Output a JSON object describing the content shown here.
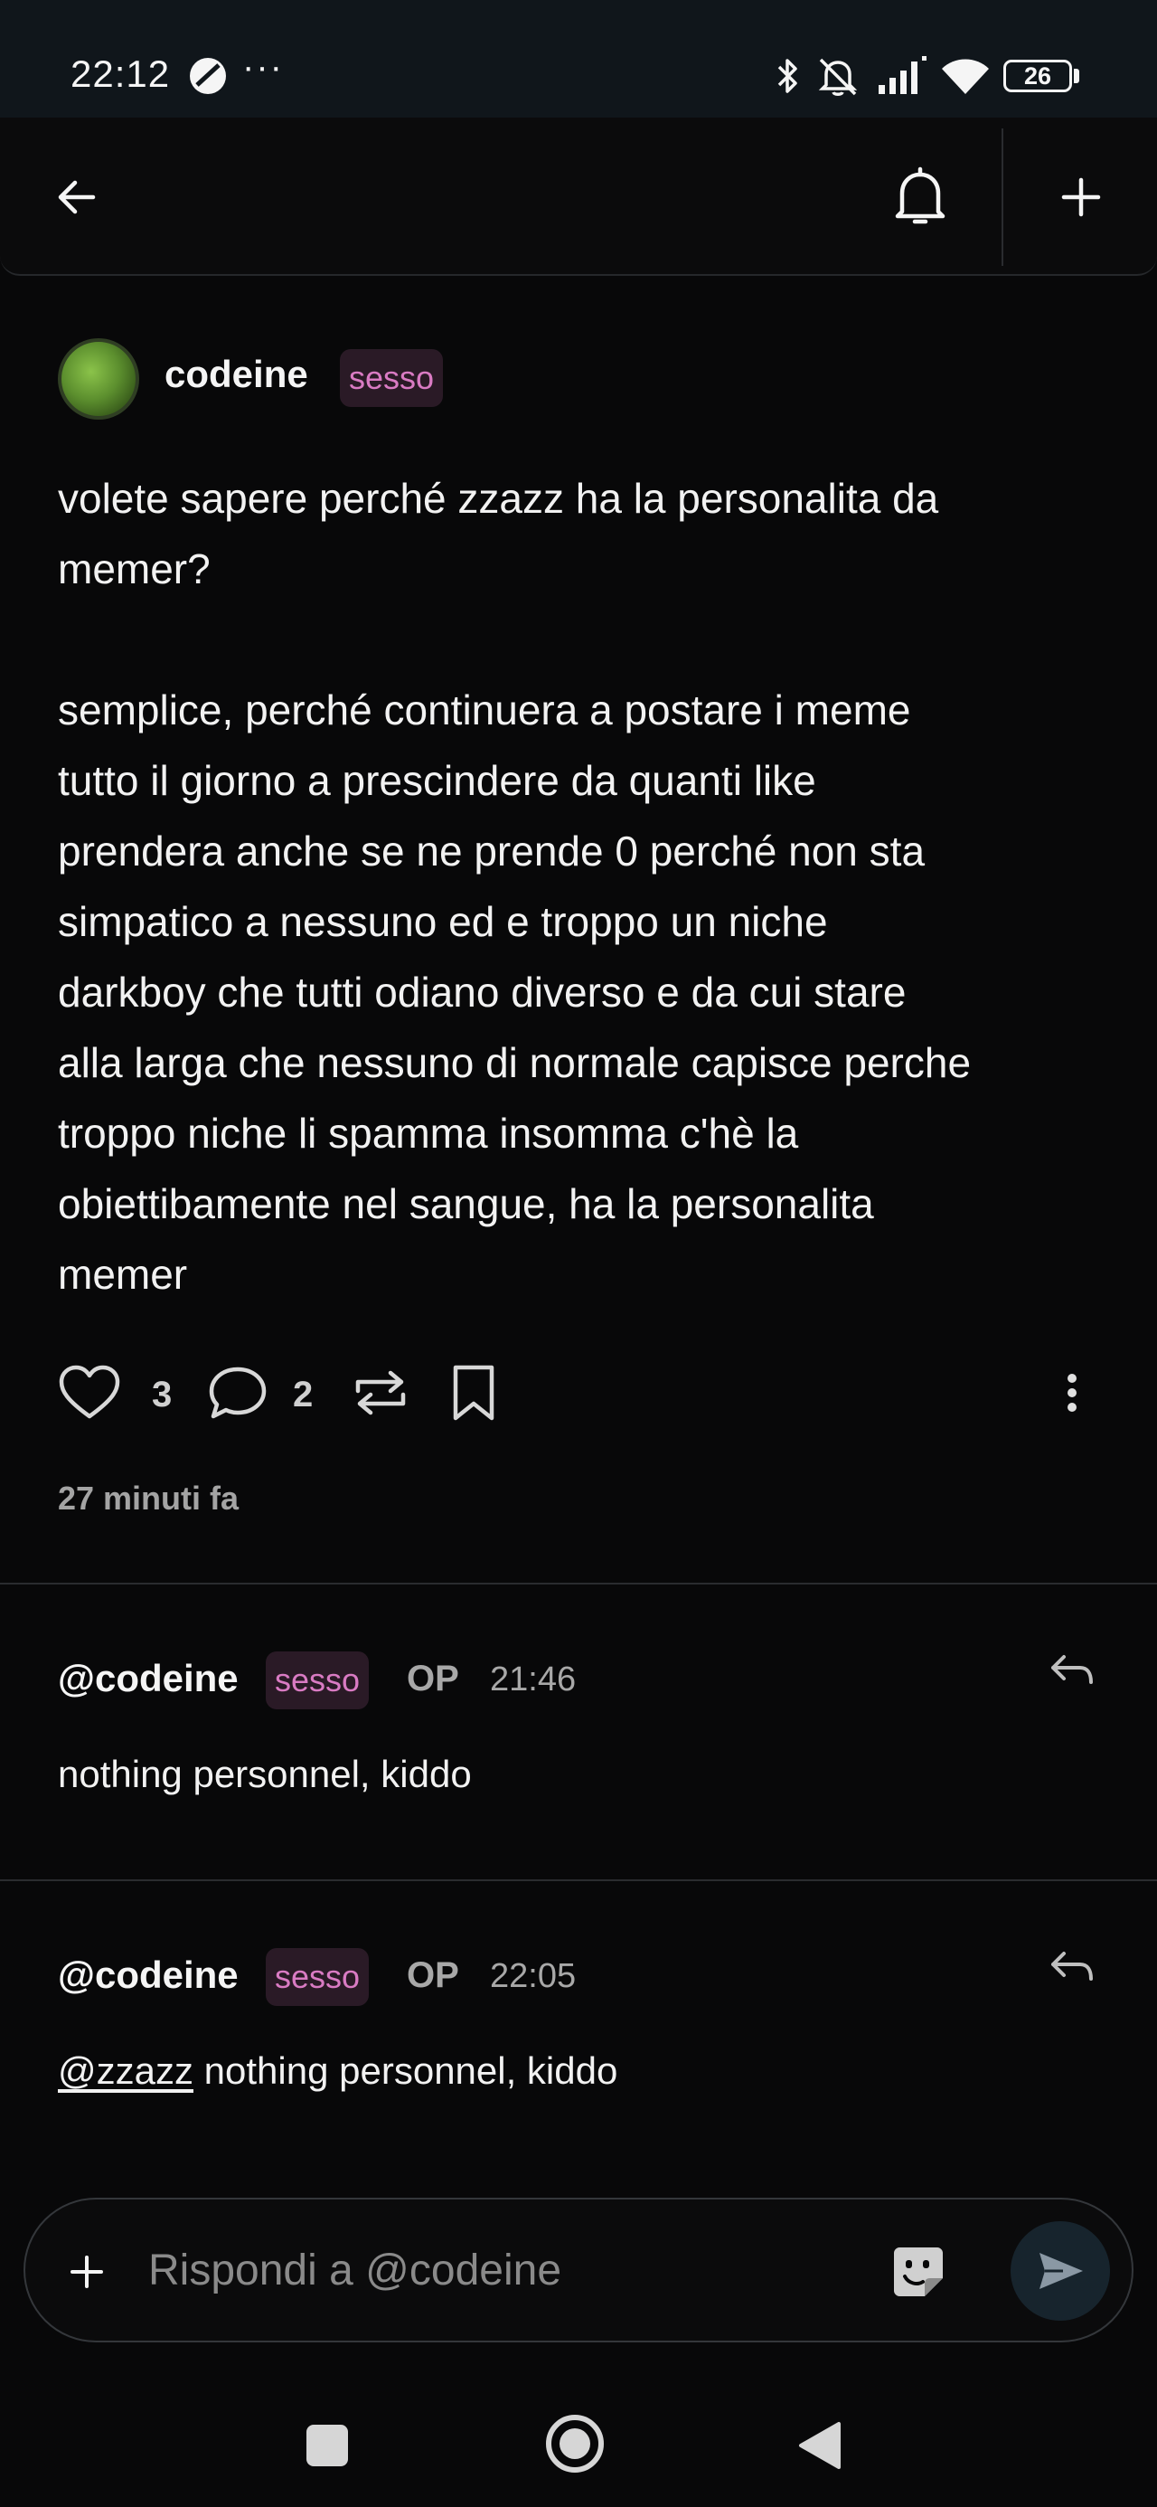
{
  "status_bar": {
    "time": "22:12",
    "more": "···",
    "battery": "26",
    "icons": [
      "app-icon",
      "bluetooth-icon",
      "muted-bell-icon",
      "signal-icon",
      "wifi-icon",
      "battery-icon"
    ]
  },
  "app_bar": {
    "icons": [
      "back-arrow-icon",
      "bell-icon",
      "plus-icon"
    ]
  },
  "post": {
    "author": "codeine",
    "flair": "sesso",
    "body": "volete sapere perché zzazz ha la personalita da\nmemer?\n\nsemplice, perché continuera a postare i meme\ntutto il giorno a prescindere da quanti like\nprendera anche se ne prende 0 perché non sta\nsimpatico a nessuno ed e troppo un niche\ndarkboy che tutti odiano diverso e da cui stare\nalla larga che nessuno di normale capisce perche\ntroppo niche li spamma insomma c'hè la\nobiettibamente nel sangue, ha la personalita\nmemer",
    "likes": "3",
    "comments": "2",
    "time_ago": "27 minuti fa"
  },
  "comments": [
    {
      "user": "@codeine",
      "flair": "sesso",
      "op": "OP",
      "time": "21:46",
      "mention": "",
      "text": "nothing personnel, kiddo"
    },
    {
      "user": "@codeine",
      "flair": "sesso",
      "op": "OP",
      "time": "22:05",
      "mention": "@zzazz",
      "text": " nothing personnel, kiddo"
    }
  ],
  "reply": {
    "placeholder": "Rispondi a @codeine",
    "value": ""
  },
  "colors": {
    "background": "#080809",
    "flair_bg": "#2a1a26",
    "flair_text": "#d97bc3",
    "send_bg": "#17242d"
  }
}
